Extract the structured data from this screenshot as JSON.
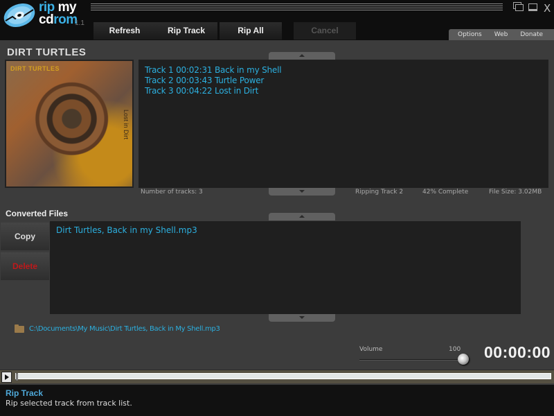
{
  "app": {
    "logo_word1": "rip",
    "logo_word2": "my",
    "logo_word3": "cd",
    "logo_word4": "rom",
    "version": "1.1",
    "window_controls": {
      "restore_icon": "restore-icon",
      "maximize_icon": "maximize-icon",
      "close_label": "X"
    }
  },
  "toolbar": {
    "buttons": [
      {
        "label": "Refresh",
        "enabled": true
      },
      {
        "label": "Rip Track",
        "enabled": true
      },
      {
        "label": "Rip All",
        "enabled": true
      },
      {
        "label": "Cancel",
        "enabled": false
      }
    ]
  },
  "tabs": [
    "Options",
    "Web",
    "Donate"
  ],
  "album": {
    "title": "DIRT TURTLES",
    "art_text": "DIRT TURTLES",
    "art_side_text": "Lost in Dirt"
  },
  "tracks": [
    {
      "label": "Track 1 00:02:31 Back in my Shell"
    },
    {
      "label": "Track 2 00:03:43 Turtle Power"
    },
    {
      "label": "Track 3 00:04:22 Lost in Dirt"
    }
  ],
  "status": {
    "track_count": "Number of tracks: 3",
    "ripping": "Ripping Track 2",
    "progress_text": "42% Complete",
    "progress_percent": 42,
    "file_size": "File Size: 3.02MB"
  },
  "converted": {
    "title": "Converted Files",
    "copy_label": "Copy",
    "delete_label": "Delete",
    "files": [
      "Dirt Turtles, Back in my Shell.mp3"
    ],
    "path": "C:\\Documents\\My Music\\Dirt Turtles, Back in My Shell.mp3"
  },
  "volume": {
    "label": "Volume",
    "value": "100",
    "fraction": 1.0
  },
  "player": {
    "time": "00:00:00",
    "seek_fraction": 0.0
  },
  "footer": {
    "title": "Rip Track",
    "description": "Rip selected track from track list."
  },
  "colors": {
    "accent": "#2cb0e0",
    "delete": "#c0181a",
    "background": "#3c3c3c",
    "list_bg": "#1f1f1f"
  }
}
